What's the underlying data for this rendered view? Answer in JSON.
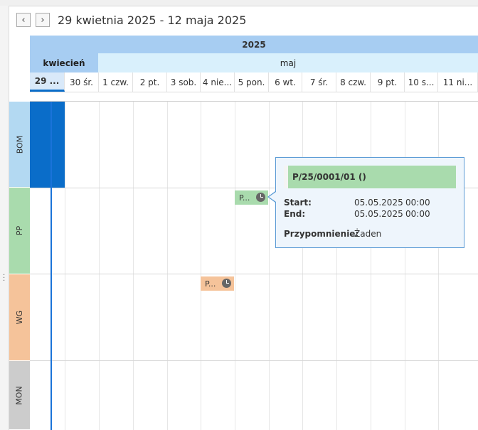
{
  "header": {
    "prev_icon": "‹",
    "next_icon": "›",
    "range_title": "29 kwietnia 2025 - 12 maja 2025"
  },
  "timeline": {
    "year": "2025",
    "months": [
      "kwiecień",
      "maj"
    ],
    "days": [
      "29 ...",
      "30 śr.",
      "1 czw.",
      "2 pt.",
      "3 sob.",
      "4 nie...",
      "5 pon.",
      "6 wt.",
      "7 śr.",
      "8 czw.",
      "9 pt.",
      "10 s...",
      "11 ni..."
    ],
    "selected_day": "29 ..."
  },
  "resources": [
    {
      "label": "BOM",
      "color": "#b3d9f2"
    },
    {
      "label": "PP",
      "color": "#a9dbad"
    },
    {
      "label": "WG",
      "color": "#f5c39a"
    },
    {
      "label": "MON",
      "color": "#cccccc"
    }
  ],
  "appointments": [
    {
      "label": "P...",
      "resource": "PP",
      "color": "#a9dbad"
    },
    {
      "label": "P...",
      "resource": "WG",
      "color": "#f5c39a"
    }
  ],
  "tooltip": {
    "title": "P/25/0001/01 ()",
    "start_label": "Start:",
    "start_date": "05.05.2025",
    "start_time": "00:00",
    "end_label": "End:",
    "end_date": "05.05.2025",
    "end_time": "00:00",
    "reminder_label": "Przypomnienie:",
    "reminder_value": "Żaden"
  },
  "colors": {
    "accent": "#0a6dc9",
    "year_bg": "#a7cdf2",
    "month_apr_bg": "#a7cdf2",
    "month_may_bg": "#d9f0fc"
  }
}
